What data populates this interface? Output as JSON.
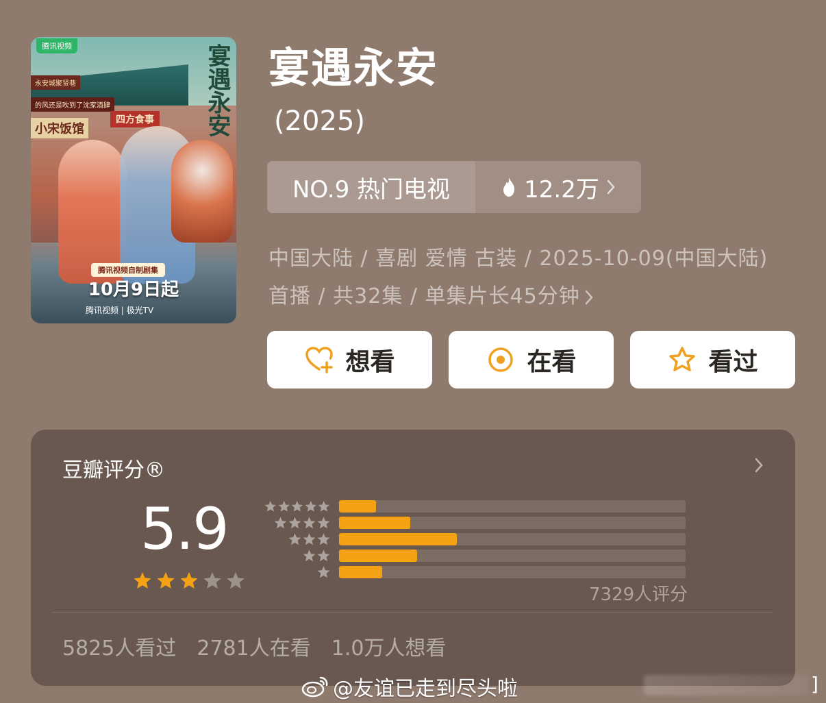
{
  "poster": {
    "platform_tag": "腾讯视频",
    "calligraphy_title": "宴遇永安",
    "sign_1": "永安城聚贤巷",
    "sign_2": "的风还是吹到了沈家酒肆",
    "sign_3": "小宋饭馆",
    "sign_4": "四方食事",
    "self_made": "腾讯视频自制剧集",
    "air_date": "10月9日起",
    "platforms": "腾讯视频 | 极光TV"
  },
  "title": "宴遇永安",
  "year": "(2025)",
  "rank": {
    "label": "NO.9 热门电视",
    "heat": "12.2万"
  },
  "meta": {
    "line1": "中国大陆 / 喜剧 爱情 古装 / 2025-10-09(中国大陆)",
    "line2": "首播 / 共32集 / 单集片长45分钟"
  },
  "actions": {
    "want": "想看",
    "watching": "在看",
    "watched": "看过"
  },
  "rating": {
    "title": "豆瓣评分®",
    "score": "5.9",
    "stars_filled": 3,
    "stars_total": 5,
    "distribution_fraction": [
      0.106,
      0.205,
      0.34,
      0.225,
      0.124
    ],
    "raters": "7329人评分",
    "watched": "5825人看过",
    "watching": "2781人在看",
    "want": "1.0万人想看"
  },
  "watermark": {
    "text": "@友谊已走到尽头啦",
    "bracket": "]"
  },
  "colors": {
    "background": "#8f7a6e",
    "card": "#69584f",
    "accent": "#f5a114",
    "icon_orange": "#f0a020"
  }
}
